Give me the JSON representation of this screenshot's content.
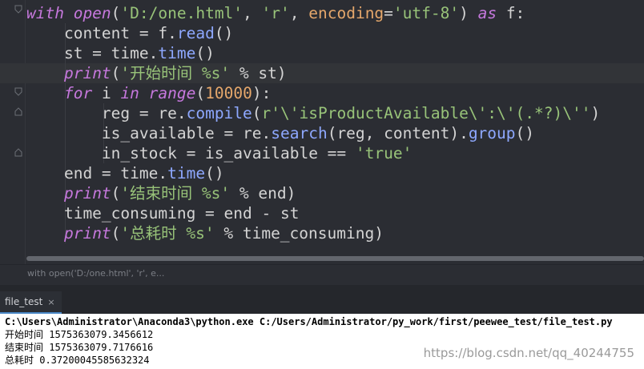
{
  "editor": {
    "lines": [
      [
        [
          "kw",
          "with "
        ],
        [
          "bi",
          "open"
        ],
        [
          "op",
          "("
        ],
        [
          "str",
          "'D:/one.html'"
        ],
        [
          "op",
          ", "
        ],
        [
          "str",
          "'r'"
        ],
        [
          "op",
          ", "
        ],
        [
          "param",
          "encoding"
        ],
        [
          "op",
          "="
        ],
        [
          "str",
          "'utf-8'"
        ],
        [
          "op",
          ") "
        ],
        [
          "kw",
          "as"
        ],
        [
          "op",
          " f:"
        ]
      ],
      [
        [
          "op",
          "    content = f."
        ],
        [
          "fn",
          "read"
        ],
        [
          "op",
          "()"
        ]
      ],
      [
        [
          "op",
          "    st = time."
        ],
        [
          "fn",
          "time"
        ],
        [
          "op",
          "()"
        ]
      ],
      [
        [
          "op",
          "    "
        ],
        [
          "bi",
          "print"
        ],
        [
          "op",
          "("
        ],
        [
          "str",
          "'开始时间 %s'"
        ],
        [
          "op",
          " % st"
        ],
        [
          "op",
          ")"
        ]
      ],
      [
        [
          "op",
          "    "
        ],
        [
          "kw",
          "for"
        ],
        [
          "op",
          " i "
        ],
        [
          "kw",
          "in"
        ],
        [
          "op",
          " "
        ],
        [
          "bi",
          "range"
        ],
        [
          "op",
          "("
        ],
        [
          "num",
          "10000"
        ],
        [
          "op",
          "):"
        ]
      ],
      [
        [
          "op",
          "        reg = re."
        ],
        [
          "fn",
          "compile"
        ],
        [
          "op",
          "("
        ],
        [
          "str",
          "r'\\'isProductAvailable\\':\\'(.*?)\\''"
        ],
        [
          "op",
          ")"
        ]
      ],
      [
        [
          "op",
          "        is_available = re."
        ],
        [
          "fn",
          "search"
        ],
        [
          "op",
          "(reg, content)."
        ],
        [
          "fn",
          "group"
        ],
        [
          "op",
          "()"
        ]
      ],
      [
        [
          "op",
          "        in_stock = is_available == "
        ],
        [
          "str",
          "'true'"
        ]
      ],
      [
        [
          "op",
          "    end = time."
        ],
        [
          "fn",
          "time"
        ],
        [
          "op",
          "()"
        ]
      ],
      [
        [
          "op",
          "    "
        ],
        [
          "bi",
          "print"
        ],
        [
          "op",
          "("
        ],
        [
          "str",
          "'结束时间 %s'"
        ],
        [
          "op",
          " % end)"
        ]
      ],
      [
        [
          "op",
          "    time_consuming = end - st"
        ]
      ],
      [
        [
          "op",
          "    "
        ],
        [
          "bi",
          "print"
        ],
        [
          "op",
          "("
        ],
        [
          "str",
          "'总耗时 %s'"
        ],
        [
          "op",
          " % time_consuming)"
        ]
      ]
    ]
  },
  "breadcrumb": "with open('D:/one.html', 'r', e...",
  "run": {
    "tab_label": "file_test",
    "close_glyph": "×",
    "console": [
      "C:\\Users\\Administrator\\Anaconda3\\python.exe C:/Users/Administrator/py_work/first/peewee_test/file_test.py",
      "开始时间 1575363079.3456612",
      "结束时间 1575363079.7176616",
      "总耗时 0.37200045585632324"
    ],
    "watermark": "https://blog.csdn.net/qq_40244755"
  },
  "icons": {
    "fold_marker": "fold-marker-icon",
    "close": "close-icon"
  },
  "colors": {
    "editor_bg": "#2b2d33",
    "keyword": "#c678dd",
    "function": "#8ea8ff",
    "string": "#98c379",
    "number": "#e5a76b",
    "tab_accent": "#4a88c7"
  }
}
